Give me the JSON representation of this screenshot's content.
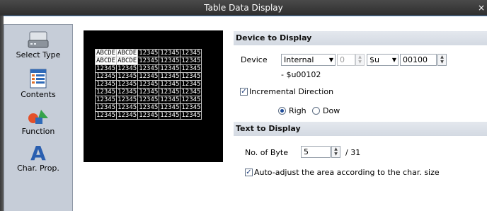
{
  "window": {
    "title": "Table Data Display",
    "close_glyph": "×"
  },
  "sidebar": {
    "items": [
      {
        "label": "Select Type",
        "icon": "drive-icon"
      },
      {
        "label": "Contents",
        "icon": "table-contents-icon"
      },
      {
        "label": "Function",
        "icon": "shapes-icon"
      },
      {
        "label": "Char. Prop.",
        "icon": "letter-a-icon"
      }
    ]
  },
  "preview": {
    "rows": [
      [
        "ABCDE",
        "ABCDE",
        "12345",
        "12345",
        "12345"
      ],
      [
        "ABCDE",
        "ABCDE",
        "12345",
        "12345",
        "12345"
      ],
      [
        "12345",
        "12345",
        "12345",
        "12345",
        "12345"
      ],
      [
        "12345",
        "12345",
        "12345",
        "12345",
        "12345"
      ],
      [
        "12345",
        "12345",
        "12345",
        "12345",
        "12345"
      ],
      [
        "12345",
        "12345",
        "12345",
        "12345",
        "12345"
      ],
      [
        "12345",
        "12345",
        "12345",
        "12345",
        "12345"
      ],
      [
        "12345",
        "12345",
        "12345",
        "12345",
        "12345"
      ],
      [
        "12345",
        "12345",
        "12345",
        "12345",
        "12345"
      ]
    ]
  },
  "device_to_display": {
    "header": "Device to Display",
    "device_label": "Device",
    "device_type": "Internal",
    "station": "0",
    "device_code": "$u",
    "address": "00100",
    "range_text": "- $u00102",
    "incremental_label": "Incremental Direction",
    "incremental_checked": true,
    "direction_right": "Righ",
    "direction_down": "Dow",
    "direction_selected": "right"
  },
  "text_to_display": {
    "header": "Text to Display",
    "bytes_label": "No. of Byte",
    "bytes_value": "5",
    "bytes_max": "/ 31",
    "auto_adjust_label": "Auto-adjust the area according to the char. size",
    "auto_adjust_checked": true
  },
  "colors": {
    "titlebar": "#3a3a3a",
    "sidebar": "#c6cdd8",
    "section_header": "#dbe0e8",
    "preview_bg": "#000000",
    "accent_blue": "#1d4c9a"
  }
}
